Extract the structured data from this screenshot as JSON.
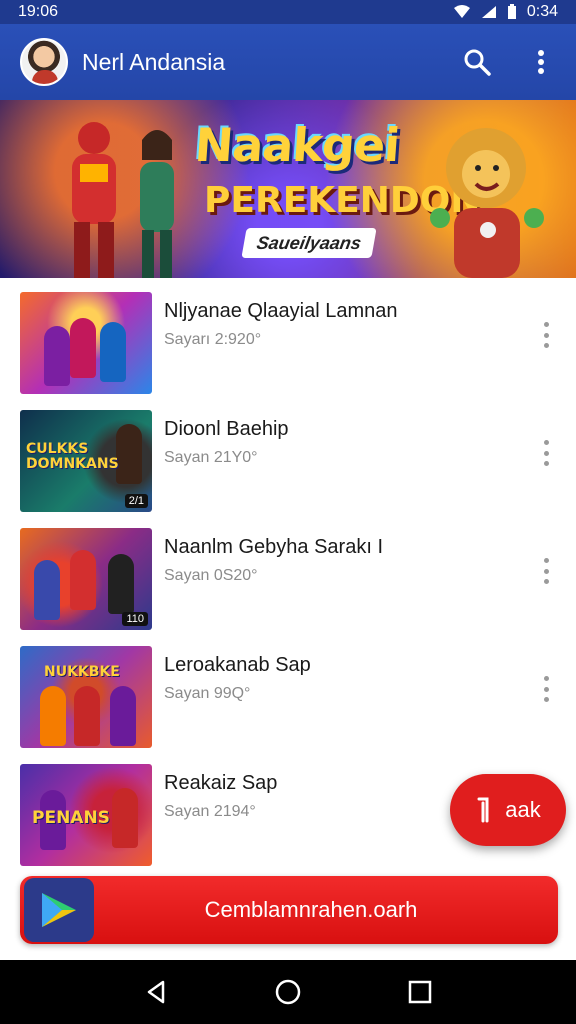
{
  "status_bar": {
    "time": "19:06",
    "battery_time": "0:34"
  },
  "app_bar": {
    "title": "Nerl Andansia",
    "avatar": "user-avatar",
    "search_icon": "search-icon",
    "more_icon": "more-vert-icon"
  },
  "banner": {
    "title": "Naakgei",
    "subtitle": "PEREKENDON",
    "tagline": "Saueilyaans"
  },
  "games": [
    {
      "title": "Nljyanae Qlaayial Lamnan",
      "subtitle": "Sayarı 2:920°",
      "thumb_text": "",
      "badge": ""
    },
    {
      "title": "Dioonl Baehip",
      "subtitle": "Sayan 21Y0°",
      "thumb_text": "CULKKS DOMNKANS",
      "badge": "2/1"
    },
    {
      "title": "Naanlm Gebyha Sarakı I",
      "subtitle": "Sayan 0S20°",
      "thumb_text": "",
      "badge": "110"
    },
    {
      "title": "Leroakanab Sap",
      "subtitle": "Sayan 99Q°",
      "thumb_text": "NUKKBKE",
      "badge": ""
    },
    {
      "title": "Reakaiz Sap",
      "subtitle": "Sayan 2194°",
      "thumb_text": "PENANS",
      "badge": ""
    }
  ],
  "fab": {
    "icon": "bookmark-icon",
    "label": "aak"
  },
  "cta": {
    "label": "Cemblamnrahen.oarh",
    "icon": "play-store-icon"
  },
  "nav": {
    "back": "back-icon",
    "home": "home-icon",
    "recents": "recents-icon"
  },
  "colors": {
    "app_bar": "#2446a8",
    "accent": "#e01e1e",
    "nav_bar": "#000000"
  }
}
